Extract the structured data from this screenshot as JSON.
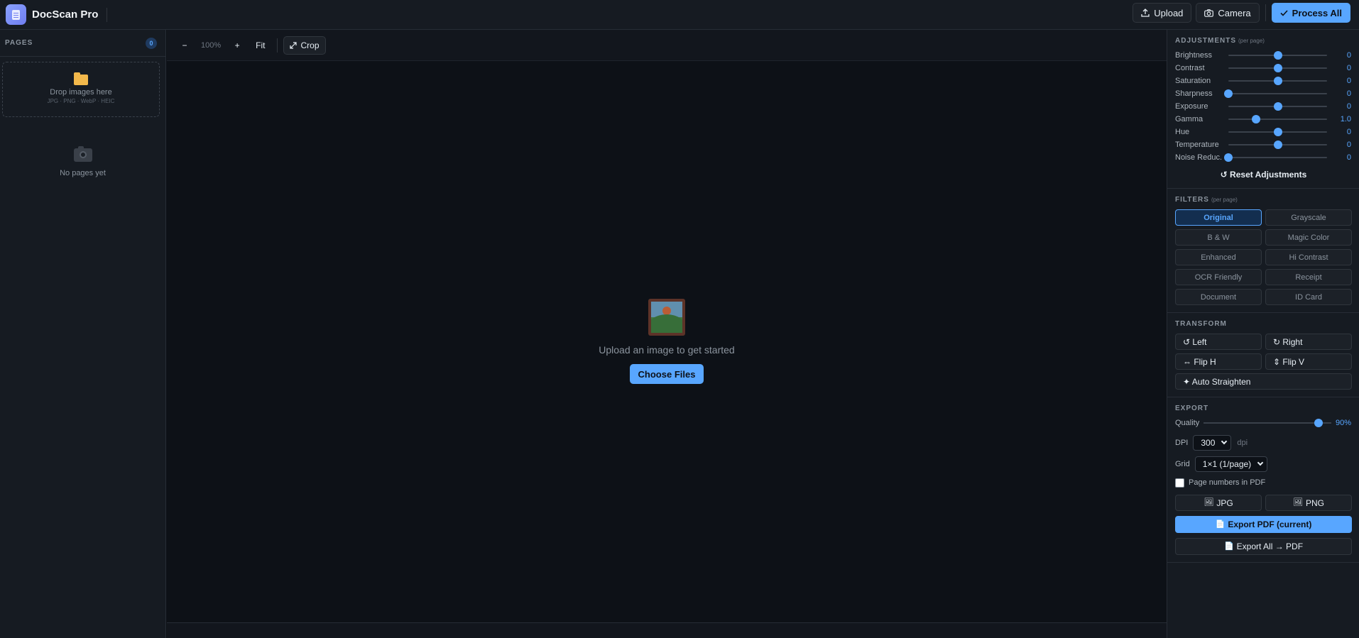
{
  "app": {
    "title": "DocScan Pro"
  },
  "header": {
    "upload_label": "Upload",
    "camera_label": "Camera",
    "process_label": "Process All"
  },
  "sidebar": {
    "pages_label": "PAGES",
    "pages_count": "0",
    "drop_title": "Drop images here",
    "drop_formats": "JPG · PNG · WebP · HEIC",
    "empty_text": "No pages yet"
  },
  "toolbar": {
    "zoom_out": "−",
    "zoom_level": "100%",
    "zoom_in": "+",
    "fit_label": "Fit",
    "crop_label": "Crop"
  },
  "canvas": {
    "empty_text": "Upload an image to get started",
    "choose_label": "Choose Files"
  },
  "adjustments": {
    "title": "ADJUSTMENTS",
    "note": "(per page)",
    "items": [
      {
        "label": "Brightness",
        "value": "0",
        "pos": 0.5
      },
      {
        "label": "Contrast",
        "value": "0",
        "pos": 0.5
      },
      {
        "label": "Saturation",
        "value": "0",
        "pos": 0.5
      },
      {
        "label": "Sharpness",
        "value": "0",
        "pos": 0.0
      },
      {
        "label": "Exposure",
        "value": "0",
        "pos": 0.5
      },
      {
        "label": "Gamma",
        "value": "1.0",
        "pos": 0.28
      },
      {
        "label": "Hue",
        "value": "0",
        "pos": 0.5
      },
      {
        "label": "Temperature",
        "value": "0",
        "pos": 0.5
      },
      {
        "label": "Noise Reduc.",
        "value": "0",
        "pos": 0.0
      }
    ],
    "reset_label": "↺ Reset Adjustments"
  },
  "filters": {
    "title": "FILTERS",
    "note": "(per page)",
    "items": [
      "Original",
      "Grayscale",
      "B & W",
      "Magic Color",
      "Enhanced",
      "Hi Contrast",
      "OCR Friendly",
      "Receipt",
      "Document",
      "ID Card"
    ],
    "active": "Original"
  },
  "transform": {
    "title": "TRANSFORM",
    "left_label": "↺ Left",
    "right_label": "↻ Right",
    "fliph_label": "⇔ Flip H",
    "flipv_label": "⇕ Flip V",
    "straighten_label": "✦ Auto Straighten"
  },
  "export": {
    "title": "EXPORT",
    "quality_label": "Quality",
    "quality_value": "90%",
    "quality_pos": 0.9,
    "dpi_label": "DPI",
    "dpi_value": "300",
    "dpi_unit": "dpi",
    "grid_label": "Grid",
    "grid_value": "1×1 (1/page)",
    "page_numbers_label": "Page numbers in PDF",
    "jpg_label": "JPG",
    "png_label": "PNG",
    "pdf_current_label": "Export PDF (current)",
    "pdf_all_label": "Export All → PDF"
  },
  "colors": {
    "accent": "#58a6ff",
    "background": "#0d1117",
    "panel": "#161b22"
  }
}
